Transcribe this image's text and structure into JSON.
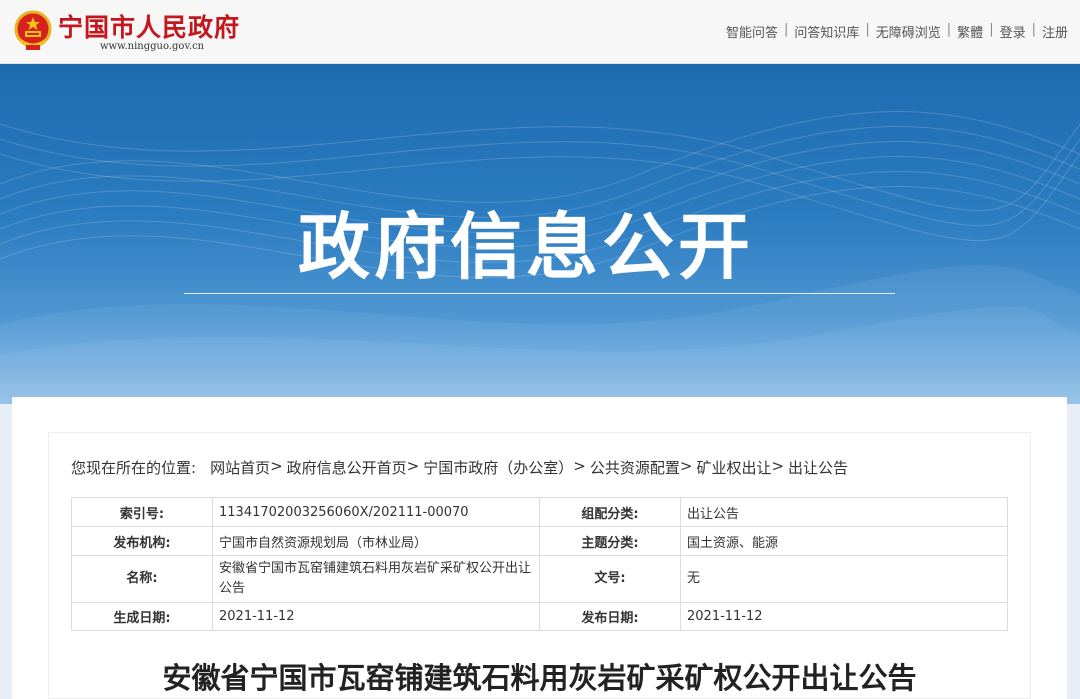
{
  "header": {
    "site_title": "宁国市人民政府",
    "site_domain": "www.ningguo.gov.cn",
    "links": [
      "智能问答",
      "问答知识库",
      "无障碍浏览",
      "繁體",
      "登录",
      "注册"
    ],
    "separator": "|"
  },
  "banner": {
    "title": "政府信息公开"
  },
  "breadcrumb": {
    "prefix": "您现在所在的位置:",
    "items": [
      "网站首页",
      "政府信息公开首页",
      "宁国市政府（办公室）",
      "公共资源配置",
      "矿业权出让",
      "出让公告"
    ],
    "arrow": ">"
  },
  "meta": {
    "index_label": "索引号:",
    "index_value": "11341702003256060X/202111-00070",
    "category_label": "组配分类:",
    "category_value": "出让公告",
    "publisher_label": "发布机构:",
    "publisher_value": "宁国市自然资源规划局（市林业局）",
    "topic_label": "主题分类:",
    "topic_value": "国土资源、能源",
    "name_label": "名称:",
    "name_value": "安徽省宁国市瓦窑铺建筑石料用灰岩矿采矿权公开出让公告",
    "docno_label": "文号:",
    "docno_value": "无",
    "created_label": "生成日期:",
    "created_value": "2021-11-12",
    "published_label": "发布日期:",
    "published_value": "2021-11-12"
  },
  "document": {
    "title": "安徽省宁国市瓦窑铺建筑石料用灰岩矿采矿权公开出让公告"
  },
  "colors": {
    "brand_red": "#c4161c",
    "banner_blue": "#1e6bb0"
  }
}
